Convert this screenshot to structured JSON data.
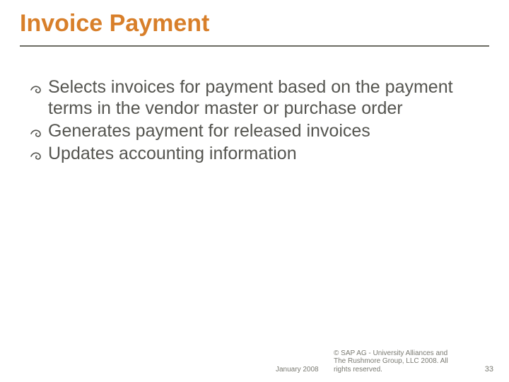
{
  "title": "Invoice Payment",
  "bullets": [
    "Selects invoices for payment based on the payment terms in the vendor master or purchase order",
    "Generates payment for released invoices",
    "Updates accounting information"
  ],
  "footer": {
    "date": "January 2008",
    "copyright": "© SAP AG - University Alliances and The Rushmore Group, LLC 2008. All rights reserved.",
    "page": "33"
  },
  "colors": {
    "title": "#d87f2a",
    "body": "#555550",
    "underline": "#6b6b63"
  }
}
